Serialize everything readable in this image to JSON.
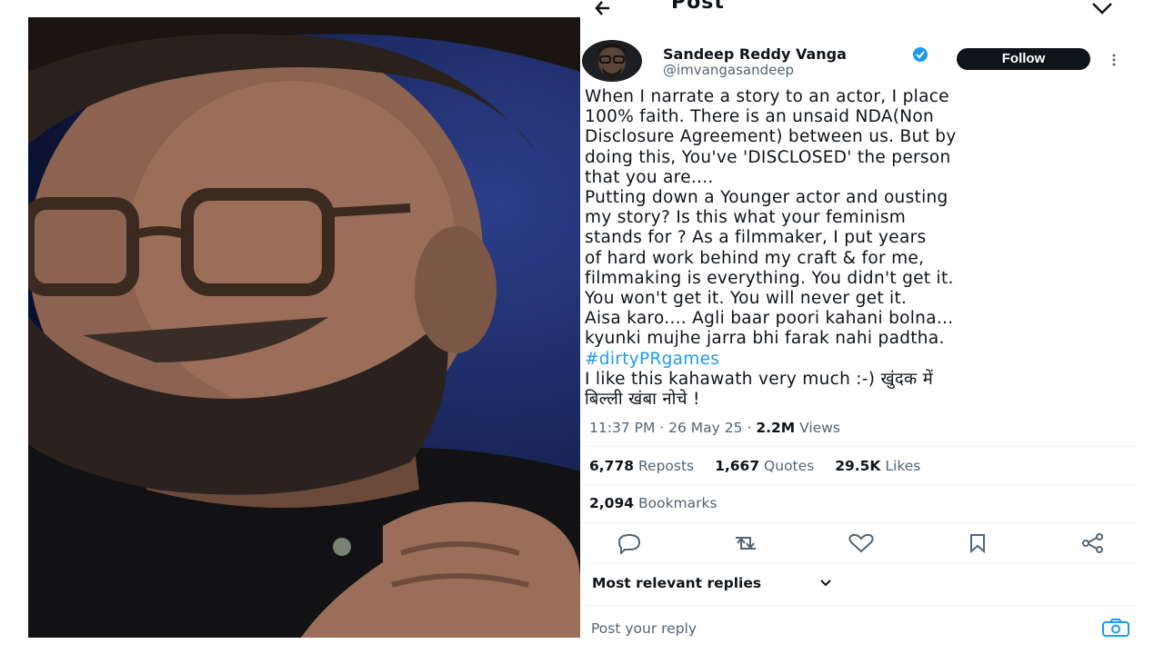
{
  "topbar": {
    "title": "Post"
  },
  "author": {
    "name": "Sandeep Reddy Vanga",
    "handle": "@imvangasandeep",
    "follow_label": "Follow"
  },
  "tweet": {
    "lines": [
      "When I narrate a story to an actor, I place",
      "100% faith. There is an unsaid NDA(Non",
      "Disclosure Agreement) between us. But by",
      "doing this, You've 'DISCLOSED' the person",
      "that you are....",
      "Putting down a Younger actor and ousting",
      "my story?  Is this what your feminism",
      "stands for ? As a filmmaker, I put years",
      "of hard work behind my craft & for me,",
      "filmmaking is everything. You didn't get it.",
      "You won't get it. You will never get it.",
      "Aisa karo.... Agli baar poori kahani bolna...",
      "kyunki mujhe jarra bhi farak nahi padtha."
    ],
    "hashtag": "#dirtyPRgames",
    "tail_lines": [
      "I like this kahawath very much :-) खुंदक में",
      "बिल्ली खंबा नोचे !"
    ]
  },
  "meta": {
    "time": "11:37 PM",
    "separator": "·",
    "date": "26 May 25",
    "views_count": "2.2M",
    "views_label": "Views"
  },
  "stats": {
    "reposts_count": "6,778",
    "reposts_label": "Reposts",
    "quotes_count": "1,667",
    "quotes_label": "Quotes",
    "likes_count": "29.5K",
    "likes_label": "Likes",
    "bookmarks_count": "2,094",
    "bookmarks_label": "Bookmarks"
  },
  "replies": {
    "sort_label": "Most relevant replies"
  },
  "reply_box": {
    "placeholder": "Post your reply"
  },
  "icons": [
    "back-arrow-icon",
    "share-icon",
    "verified-badge-icon",
    "more-icon",
    "reply-icon",
    "repost-icon",
    "like-icon",
    "bookmark-icon",
    "share-icon",
    "chevron-down-icon",
    "camera-icon"
  ],
  "colors": {
    "text": "#0f1419",
    "muted": "#536471",
    "accent": "#1d9bf0",
    "button": "#0f1419"
  }
}
